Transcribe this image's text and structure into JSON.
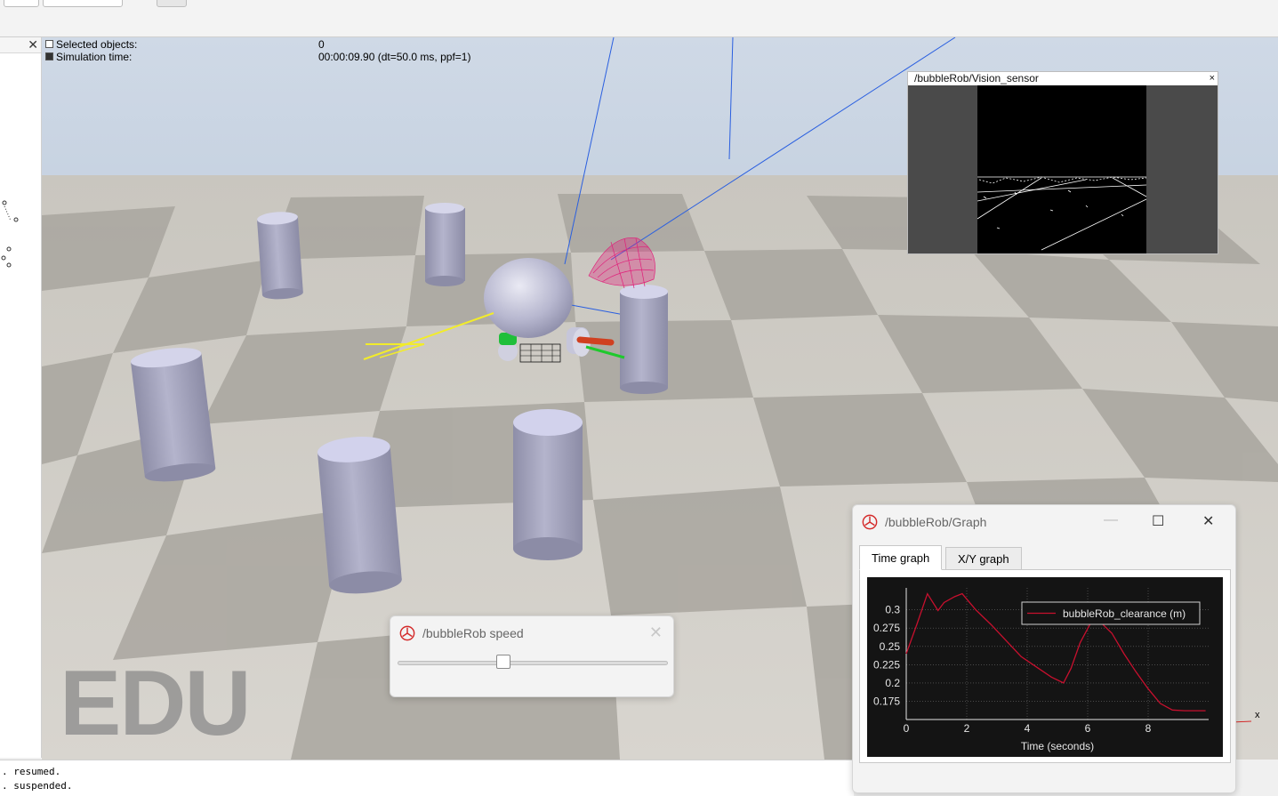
{
  "info": {
    "selected_label": "Selected objects:",
    "selected_value": "0",
    "simtime_label": "Simulation time:",
    "simtime_value": "00:00:09.90 (dt=50.0 ms, ppf=1)"
  },
  "watermark": "EDU",
  "vision_sensor": {
    "title": "/bubbleRob/Vision_sensor",
    "close": "×"
  },
  "speed_dialog": {
    "title": "/bubbleRob speed",
    "slider_value_fraction": 0.39
  },
  "graph_dialog": {
    "title": "/bubbleRob/Graph",
    "tabs": [
      {
        "label": "Time graph"
      },
      {
        "label": "X/Y graph"
      }
    ]
  },
  "console": {
    "lines": [
      ". resumed.",
      ". suspended."
    ]
  },
  "axis_label_x": "x",
  "colors": {
    "accent_red": "#d42a2a",
    "plot_bg": "#141414",
    "curve": "#c8102e"
  },
  "chart_data": {
    "type": "line",
    "xlabel": "Time (seconds)",
    "ylabel": "",
    "xlim": [
      0,
      10
    ],
    "ylim": [
      0.15,
      0.33
    ],
    "x_ticks": [
      0,
      2,
      4,
      6,
      8
    ],
    "y_ticks": [
      0.175,
      0.2,
      0.225,
      0.25,
      0.275,
      0.3
    ],
    "grid": true,
    "legend_position": "top-right",
    "series": [
      {
        "name": "bubbleRob_clearance (m)",
        "x": [
          0,
          0.35,
          0.7,
          1.05,
          1.25,
          1.6,
          1.85,
          2.3,
          2.8,
          3.3,
          3.8,
          4.3,
          4.8,
          5.2,
          5.45,
          5.75,
          6.1,
          6.45,
          6.8,
          7.2,
          7.6,
          8.0,
          8.4,
          8.8,
          9.2,
          9.6,
          9.9
        ],
        "y": [
          0.24,
          0.28,
          0.322,
          0.299,
          0.31,
          0.318,
          0.322,
          0.3,
          0.28,
          0.258,
          0.236,
          0.222,
          0.208,
          0.2,
          0.22,
          0.255,
          0.282,
          0.282,
          0.268,
          0.24,
          0.215,
          0.192,
          0.172,
          0.163,
          0.162,
          0.162,
          0.162
        ]
      }
    ]
  }
}
